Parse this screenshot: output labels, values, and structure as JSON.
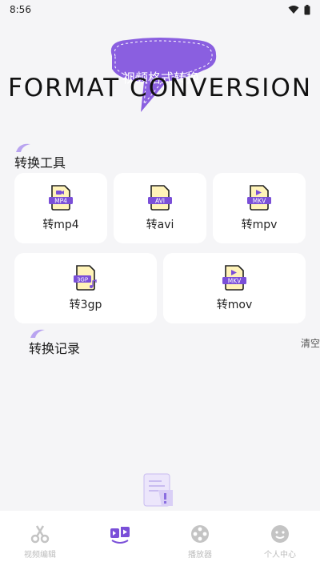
{
  "status_bar": {
    "time": "8:56",
    "icons": [
      "wifi-icon",
      "battery-icon"
    ]
  },
  "banner": {
    "bubble_text": "视频格式转换",
    "title": "FORMAT CONVERSION"
  },
  "tools_section": {
    "title": "转换工具",
    "tools": [
      {
        "id": "mp4",
        "badge": "MP4",
        "label": "转mp4",
        "icon": "video-file-icon"
      },
      {
        "id": "avi",
        "badge": "AVI",
        "label": "转avi",
        "icon": "document-file-icon"
      },
      {
        "id": "mpv",
        "badge": "MKV",
        "label": "转mpv",
        "icon": "play-file-icon"
      },
      {
        "id": "3gp",
        "badge": "3GP",
        "label": "转3gp",
        "icon": "music-file-icon"
      },
      {
        "id": "mov",
        "badge": "MKV",
        "label": "转mov",
        "icon": "play-file-icon"
      }
    ]
  },
  "history_section": {
    "title": "转换记录",
    "clear_label": "清空"
  },
  "bottom_nav": {
    "items": [
      {
        "label": "视频编辑",
        "icon": "scissors-icon"
      },
      {
        "label": "",
        "icon": "format-convert-icon"
      },
      {
        "label": "播放器",
        "icon": "film-reel-icon"
      },
      {
        "label": "个人中心",
        "icon": "smiley-face-icon"
      }
    ]
  },
  "colors": {
    "accent": "#7a4fd8",
    "badge": "#7a4fd8",
    "file_yellow": "#fff3b8",
    "background": "#f5f5f7",
    "nav_inactive": "#bdbdbd"
  }
}
